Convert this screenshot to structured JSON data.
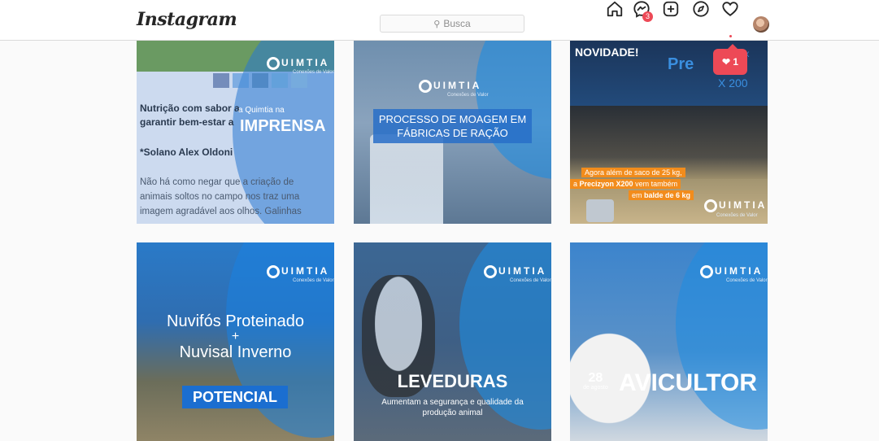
{
  "header": {
    "logo": "Instagram",
    "search_placeholder": "Busca",
    "messages_badge": "3",
    "notification_count": "1"
  },
  "posts": [
    {
      "brand": "UIMTIA",
      "brand_sub": "Conexões de Valor",
      "article_title": "Nutrição com sabor a",
      "article_title2": "garantir bem-estar a",
      "tag_small": "a Quimtia na",
      "tag_big": "IMPRENSA",
      "author": "*Solano Alex Oldoni",
      "body1": "Não há como negar que a criação de",
      "body2": "animais soltos no campo nos traz uma",
      "body3": "imagem agradável aos olhos. Galinhas"
    },
    {
      "brand": "UIMTIA",
      "brand_sub": "Conexões de Valor",
      "line1": "PROCESSO DE MOAGEM EM",
      "line2": "FÁBRICAS DE RAÇÃO"
    },
    {
      "headline": "NOVIDADE!",
      "product": "Pre",
      "product_suffix": "n",
      "x200": "X 200",
      "ix": "IX",
      "offer1": "Agora além de saco de 25 kg,",
      "offer2a": "a ",
      "offer2b": "Precizyon X200",
      "offer2c": " vem também",
      "offer3a": "em ",
      "offer3b": "balde de 6 kg",
      "brand": "UIMTIA",
      "brand_sub": "Conexões de Valor"
    },
    {
      "brand": "UIMTIA",
      "brand_sub": "Conexões de Valor",
      "line1": "Nuvifós Proteinado",
      "plus": "+",
      "line2": "Nuvisal Inverno",
      "badge": "POTENCIAL"
    },
    {
      "brand": "UIMTIA",
      "brand_sub": "Conexões de Valor",
      "title": "LEVEDURAS",
      "sub1": "Aumentam a segurança e qualidade da",
      "sub2": "produção animal"
    },
    {
      "brand": "UIMTIA",
      "brand_sub": "Conexões de Valor",
      "day": "28",
      "month": "de agosto",
      "title": "AVICULTOR"
    }
  ],
  "colors": {
    "accent_blue": "#1f7fd6",
    "badge_red": "#ed4956"
  }
}
